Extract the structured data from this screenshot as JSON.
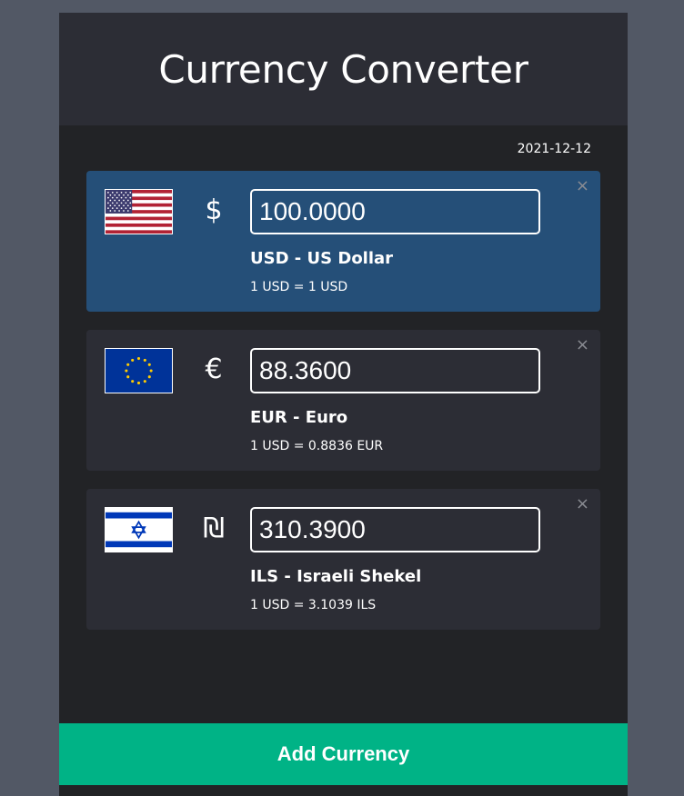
{
  "header": {
    "title": "Currency Converter"
  },
  "date": "2021-12-12",
  "colors": {
    "page_bg": "#525865",
    "panel_bg": "#222326",
    "card_bg": "#2c2d35",
    "base_card_bg": "#254f78",
    "accent": "#00b386"
  },
  "currencies": [
    {
      "flag_icon": "us-flag-icon",
      "symbol": "$",
      "amount": "100.0000",
      "name": "USD - US Dollar",
      "rate": "1 USD = 1 USD",
      "close": "×"
    },
    {
      "flag_icon": "eu-flag-icon",
      "symbol": "€",
      "amount": "88.3600",
      "name": "EUR - Euro",
      "rate": "1 USD = 0.8836 EUR",
      "close": "×"
    },
    {
      "flag_icon": "israel-flag-icon",
      "symbol": "₪",
      "amount": "310.3900",
      "name": "ILS - Israeli Shekel",
      "rate": "1 USD = 3.1039 ILS",
      "close": "×"
    }
  ],
  "add_button": {
    "label": "Add Currency"
  }
}
